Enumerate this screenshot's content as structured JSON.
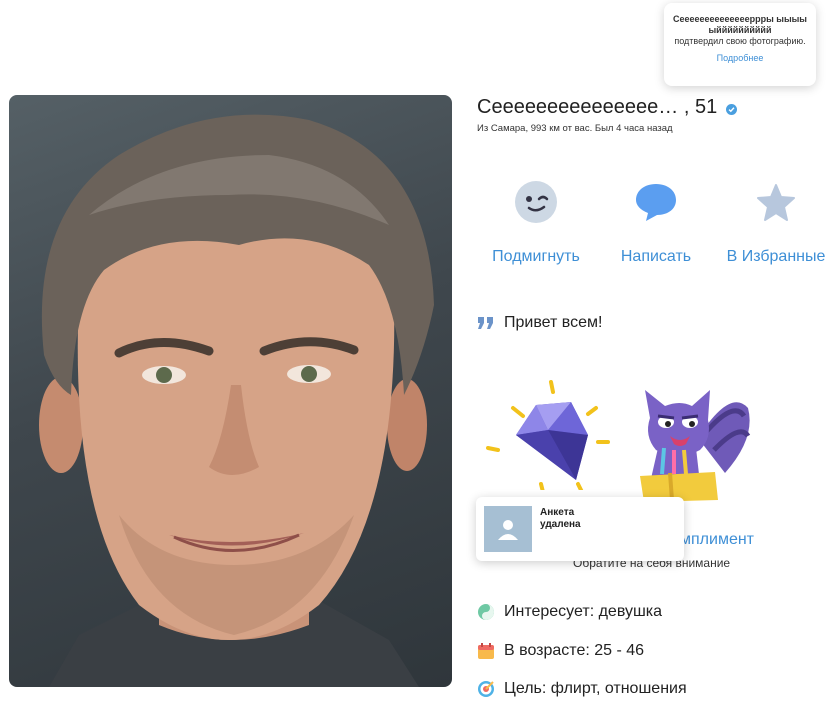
{
  "profile": {
    "name_age": "Сеееееееееееееее… , 51",
    "location_line": "Из Самара, 993 км от вас. Был 4 часа назад",
    "status_text": "Привет всем!"
  },
  "tooltip": {
    "name": "Сееееееееееееееррры ыыыыыйййййййййй",
    "text": "подтвердил свою фотографию.",
    "link": "Подробнее"
  },
  "actions": [
    {
      "label": "Подмигнуть",
      "icon": "wink-emoji-icon"
    },
    {
      "label": "Написать",
      "icon": "chat-bubble-icon"
    },
    {
      "label": "В Избранные",
      "icon": "star-icon"
    }
  ],
  "compliment": {
    "link": "мплимент",
    "sub": "Обратите на себя внимание"
  },
  "deleted_card": {
    "text": "Анкета удалена"
  },
  "info": [
    {
      "icon": "yin-yang-icon",
      "text": "Интересует: девушка"
    },
    {
      "icon": "calendar-icon",
      "text": "В возрасте: 25 - 46"
    },
    {
      "icon": "target-icon",
      "text": "Цель: флирт, отношения"
    }
  ],
  "colors": {
    "accent": "#3e8fd6",
    "verified": "#4a9fdf",
    "avatar_placeholder": "#a6bfd3"
  }
}
